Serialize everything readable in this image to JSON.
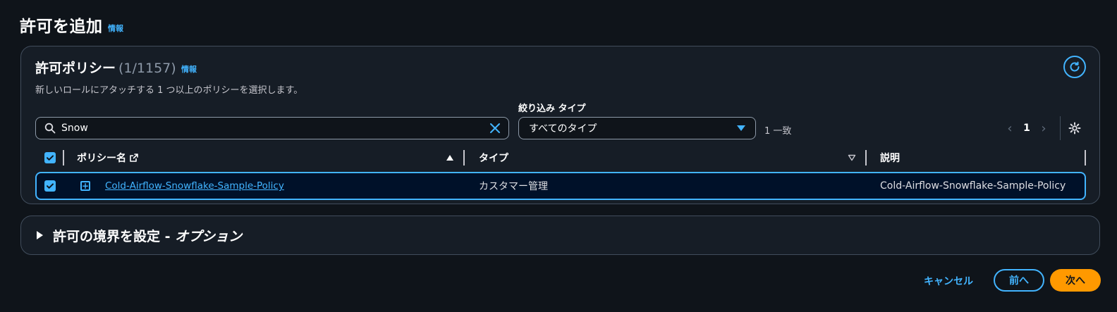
{
  "page": {
    "title": "許可を追加",
    "info_label": "情報"
  },
  "policies": {
    "title": "許可ポリシー",
    "count": "(1/1157)",
    "info_label": "情報",
    "description": "新しいロールにアタッチする 1 つ以上のポリシーを選択します。",
    "refresh_icon": "refresh-icon"
  },
  "filter": {
    "search_value": "Snow",
    "type_label": "絞り込み タイプ",
    "type_selected": "すべてのタイプ",
    "match_count": "1 一致"
  },
  "pagination": {
    "current_page": "1"
  },
  "table": {
    "columns": {
      "name": "ポリシー名",
      "type": "タイプ",
      "description": "説明"
    },
    "rows": [
      {
        "name": "Cold-Airflow-Snowflake-Sample-Policy",
        "type": "カスタマー管理",
        "description": "Cold-Airflow-Snowflake-Sample-Policy",
        "selected": true
      }
    ]
  },
  "boundary": {
    "title_main": "許可の境界を設定 - ",
    "title_option": "オプション"
  },
  "footer": {
    "cancel_label": "キャンセル",
    "prev_label": "前へ",
    "next_label": "次へ"
  },
  "colors": {
    "accent": "#42b4ff",
    "primary_button": "#ff9900",
    "background": "#0f141a",
    "container": "#161d26"
  }
}
